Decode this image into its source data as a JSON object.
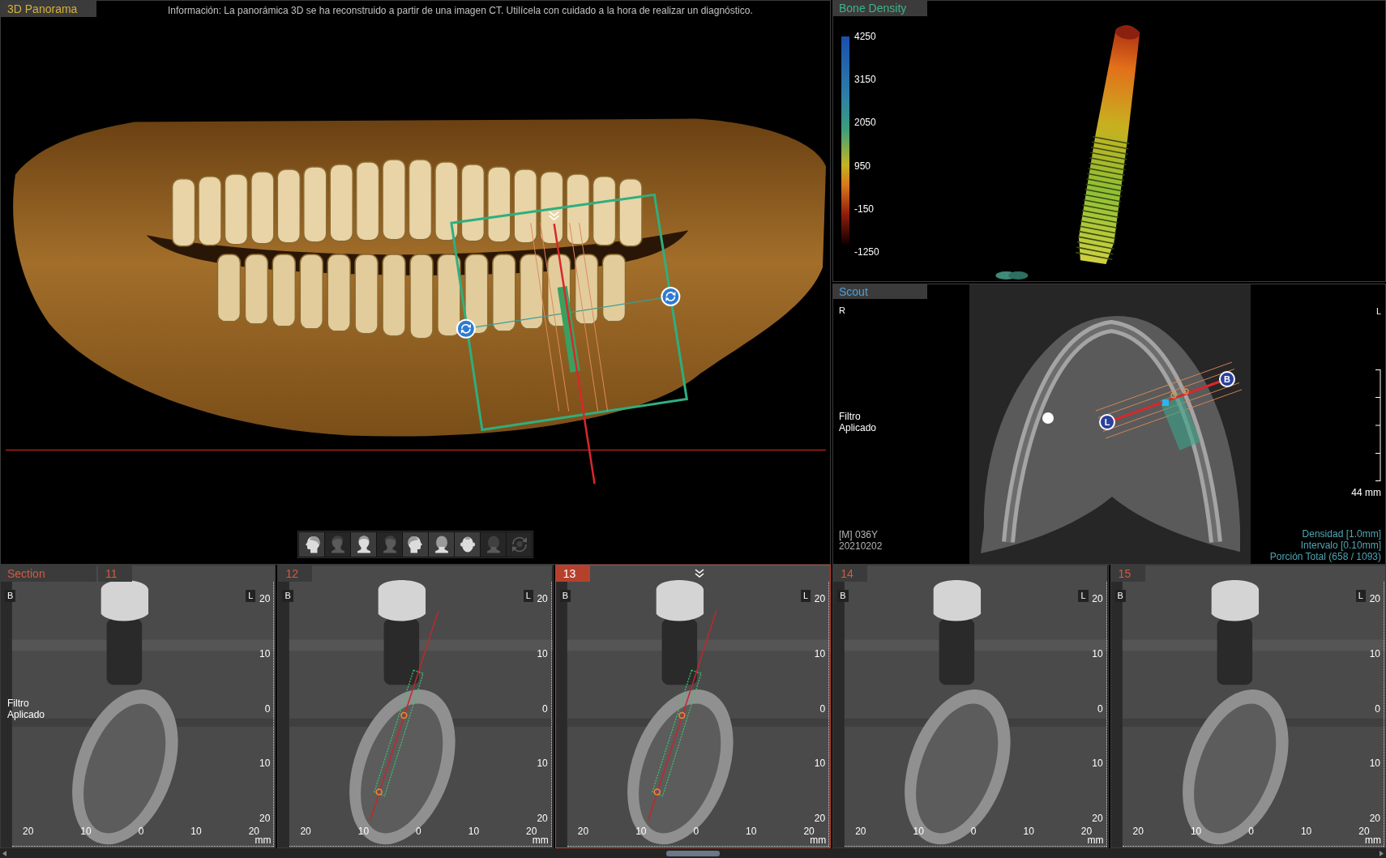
{
  "panorama": {
    "title": "3D Panorama",
    "info": "Información: La panorámica 3D se ha reconstruido a partir de una imagen CT. Utilícela con cuidado a la hora de realizar un diagnóstico.",
    "view_buttons": [
      {
        "kind": "profile-left",
        "disabled": false
      },
      {
        "kind": "oblique-left",
        "disabled": true
      },
      {
        "kind": "front",
        "disabled": false
      },
      {
        "kind": "oblique-right",
        "disabled": true
      },
      {
        "kind": "profile-right",
        "disabled": false
      },
      {
        "kind": "back",
        "disabled": false
      },
      {
        "kind": "top",
        "disabled": false
      },
      {
        "kind": "back",
        "disabled": true
      },
      {
        "kind": "rotate",
        "disabled": true
      }
    ]
  },
  "bone_density": {
    "title": "Bone Density",
    "scale_labels": [
      "4250",
      "3150",
      "2050",
      "950",
      "-150",
      "-1250"
    ]
  },
  "scout": {
    "title": "Scout",
    "side_left": "R",
    "side_right": "L",
    "note": "Filtro Aplicado",
    "patient": "[M] 036Y",
    "date": "20210202",
    "scale": "44 mm",
    "stats": [
      "Densidad [1.0mm]",
      "Intervalo [0.10mm]",
      "Porción Total (658 / 1093)"
    ],
    "markers": [
      {
        "label": "B"
      },
      {
        "label": "L"
      }
    ]
  },
  "sections": {
    "title": "Section",
    "panels": [
      {
        "label": "11",
        "selected": false,
        "implant": false,
        "note": "Filtro Aplicado",
        "side_left": "B",
        "side_right": "L",
        "y_ticks": [
          "20",
          "10",
          "0",
          "10",
          "20"
        ],
        "x_ticks": [
          "20",
          "10",
          "0",
          "10",
          "20"
        ],
        "unit": "mm"
      },
      {
        "label": "12",
        "selected": false,
        "implant": true,
        "side_left": "B",
        "side_right": "L",
        "y_ticks": [
          "20",
          "10",
          "0",
          "10",
          "20"
        ],
        "x_ticks": [
          "20",
          "10",
          "0",
          "10",
          "20"
        ],
        "unit": "mm"
      },
      {
        "label": "13",
        "selected": true,
        "implant": true,
        "side_left": "B",
        "side_right": "L",
        "y_ticks": [
          "20",
          "10",
          "0",
          "10",
          "20"
        ],
        "x_ticks": [
          "20",
          "10",
          "0",
          "10",
          "20"
        ],
        "unit": "mm"
      },
      {
        "label": "14",
        "selected": false,
        "implant": false,
        "side_left": "B",
        "side_right": "L",
        "y_ticks": [
          "20",
          "10",
          "0",
          "10",
          "20"
        ],
        "x_ticks": [
          "20",
          "10",
          "0",
          "10",
          "20"
        ],
        "unit": "mm"
      },
      {
        "label": "15",
        "selected": false,
        "implant": false,
        "side_left": "B",
        "side_right": "L",
        "y_ticks": [
          "20",
          "10",
          "0",
          "10",
          "20"
        ],
        "x_ticks": [
          "20",
          "10",
          "0",
          "10",
          "20"
        ],
        "unit": "mm"
      }
    ]
  }
}
